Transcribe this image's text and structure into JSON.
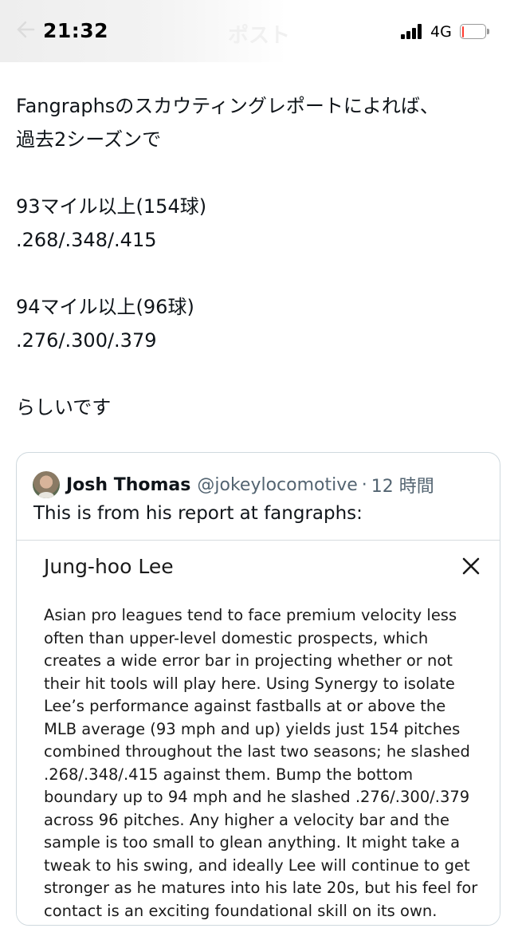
{
  "status_bar": {
    "time": "21:32",
    "network": "4G",
    "header_title": "ポスト",
    "back_icon": "arrow-left-icon",
    "battery_color": "#ff3b30"
  },
  "post": {
    "lines": [
      "Fangraphsのスカウティングレポートによれば、",
      "過去2シーズンで",
      "",
      "93マイル以上(154球)",
      ".268/.348/.415",
      "",
      "94マイル以上(96球)",
      ".276/.300/.379",
      "",
      "らしいです"
    ]
  },
  "quote": {
    "author_name": "Josh Thomas",
    "author_handle": "@jokeylocomotive",
    "separator": "·",
    "time": "12 時間",
    "text": "This is from his report at fangraphs:",
    "report": {
      "title": "Jung-hoo Lee",
      "close_icon": "close-icon",
      "body_lines": [
        "Asian pro leagues tend to face premium velocity less",
        "often than upper-level domestic prospects, which",
        "creates a wide error bar in projecting whether or not",
        "their hit tools will play here. Using Synergy to isolate",
        "Lee’s performance against fastballs at or above the",
        "MLB average (93 mph and up) yields just 154 pitches",
        "combined throughout the last two seasons; he slashed",
        ".268/.348/.415 against them. Bump the bottom",
        "boundary up to 94 mph and he slashed .276/.300/.379",
        "across 96 pitches. Any higher a velocity bar and the",
        "sample is too small to glean anything. It might take a",
        "tweak to his swing, and ideally Lee will continue to get",
        "stronger as he matures into his late 20s, but his feel for",
        "contact is an exciting foundational skill on its own."
      ]
    }
  }
}
